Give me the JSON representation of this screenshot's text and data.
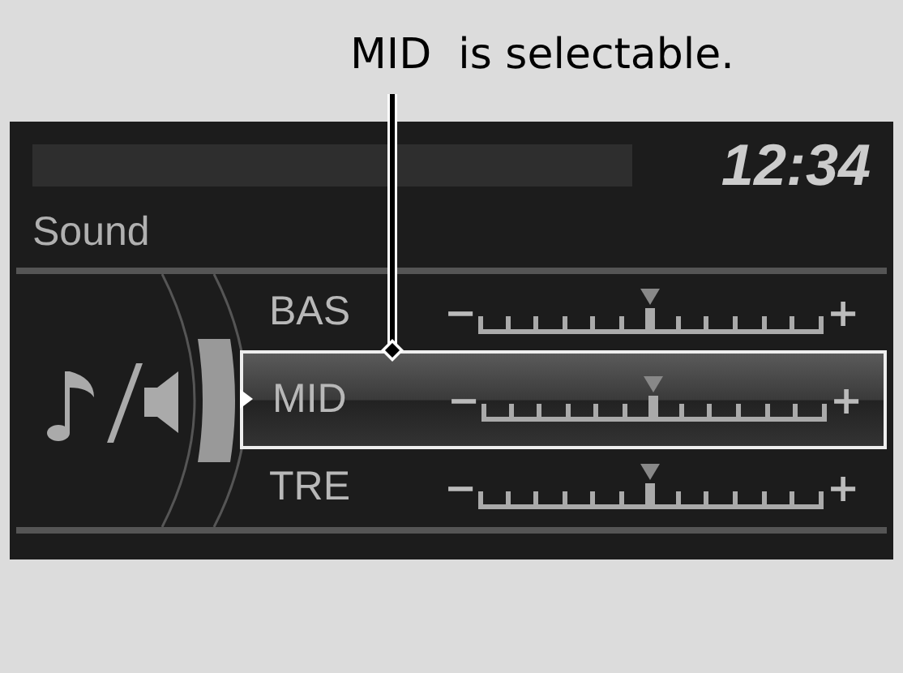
{
  "callout": {
    "text": "MID  is selectable."
  },
  "screen": {
    "clock": "12:34",
    "title": "Sound",
    "rows": [
      {
        "label": "BAS",
        "selected": false,
        "level": 0.5,
        "minus": "−",
        "plus": "+"
      },
      {
        "label": "MID",
        "selected": true,
        "level": 0.5,
        "minus": "−",
        "plus": "+"
      },
      {
        "label": "TRE",
        "selected": false,
        "level": 0.5,
        "minus": "−",
        "plus": "+"
      }
    ]
  }
}
